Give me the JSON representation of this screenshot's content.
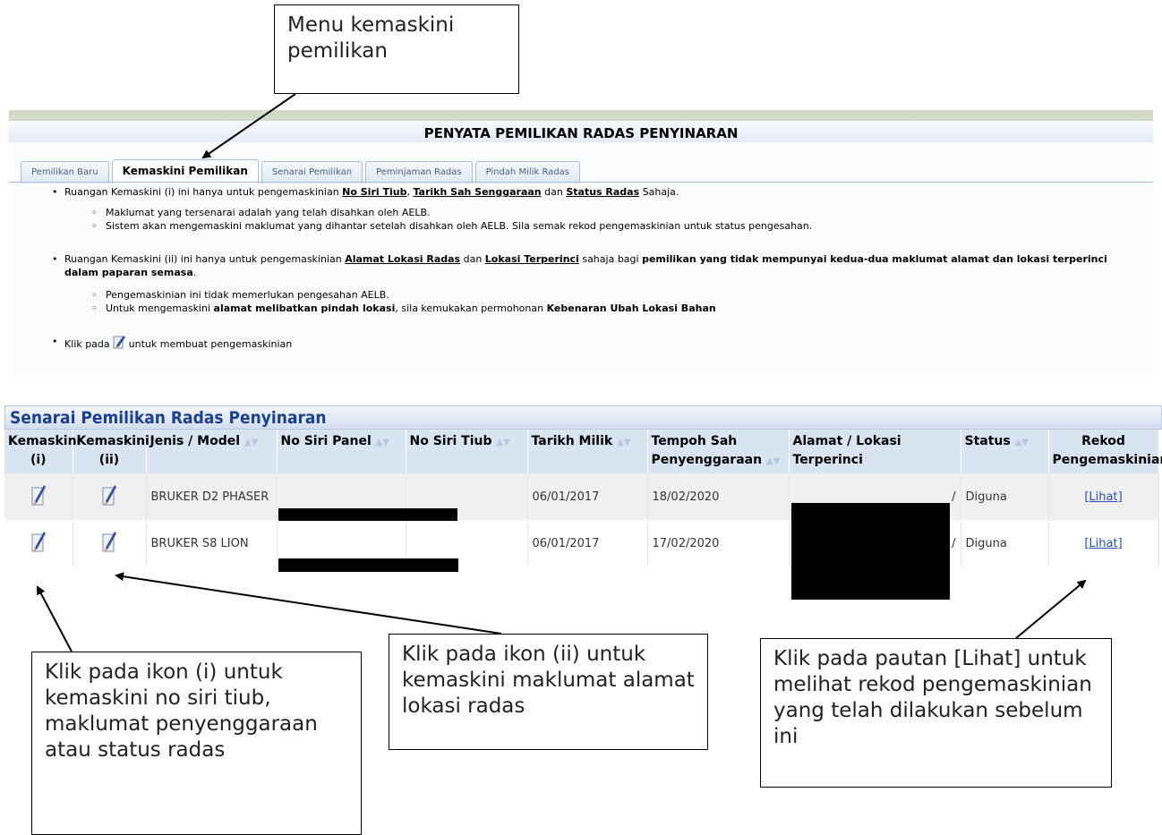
{
  "callouts": {
    "menu": "Menu kemaskini pemilikan",
    "icon_i": "Klik pada ikon (i) untuk kemaskini no siri tiub, maklumat penyenggaraan atau status radas",
    "icon_ii": "Klik pada ikon (ii) untuk kemaskini maklumat alamat lokasi radas",
    "lihat": "Klik pada pautan [Lihat] untuk melihat rekod pengemaskinian yang telah dilakukan sebelum ini"
  },
  "page_title": "PENYATA PEMILIKAN RADAS PENYINARAN",
  "tabs": [
    {
      "label": "Pemilikan Baru"
    },
    {
      "label": "Kemaskini Pemilikan"
    },
    {
      "label": "Senarai Pemilikan"
    },
    {
      "label": "Peminjaman Radas"
    },
    {
      "label": "Pindah Milik Radas"
    }
  ],
  "info": {
    "p1_a": "Ruangan Kemaskini (i) ini hanya untuk pengemaskinian ",
    "p1_l1": "No Siri Tiub",
    "p1_sep1": ", ",
    "p1_l2": "Tarikh Sah Senggaraan",
    "p1_and": " dan ",
    "p1_l3": "Status Radas",
    "p1_end": " Sahaja.",
    "s1": "Maklumat yang tersenarai adalah yang telah disahkan oleh AELB.",
    "s2": "Sistem akan mengemaskini maklumat yang dihantar setelah disahkan oleh AELB. Sila semak rekod pengemaskinian untuk status pengesahan.",
    "p2_a": "Ruangan Kemaskini (ii) ini hanya untuk pengemaskinian ",
    "p2_l1": "Alamat Lokasi Radas",
    "p2_and": " dan ",
    "p2_l2": "Lokasi Terperinci",
    "p2_b": " sahaja bagi ",
    "p2_bold": "pemilikan yang tidak mempunyai kedua-dua maklumat alamat dan lokasi terperinci dalam paparan semasa",
    "p2_end": ".",
    "s3": "Pengemaskinian ini tidak memerlukan pengesahan AELB.",
    "s4_a": "Untuk mengemaskini ",
    "s4_bold1": "alamat melibatkan pindah lokasi",
    "s4_b": ", sila kemukakan permohonan ",
    "s4_bold2": "Kebenaran Ubah Lokasi Bahan",
    "p3_a": "Klik pada ",
    "p3_b": " untuk membuat pengemaskinian"
  },
  "grid": {
    "title": "Senarai Pemilikan Radas Penyinaran",
    "headers": {
      "k1_a": "Kemaskini",
      "k1_b": "(i)",
      "k2_a": "Kemaskini",
      "k2_b": "(ii)",
      "jenis": "Jenis / Model",
      "panel": "No Siri Panel",
      "tiub": "No Siri Tiub",
      "tarikh": "Tarikh Milik",
      "tempoh_a": "Tempoh Sah",
      "tempoh_b": "Penyenggaraan",
      "alamat": "Alamat / Lokasi Terperinci",
      "status": "Status",
      "rekod_a": "Rekod",
      "rekod_b": "Pengemaskinian"
    },
    "rows": [
      {
        "model": "BRUKER D2 PHASER",
        "tarikh": "06/01/2017",
        "tempoh": "18/02/2020",
        "alamat": "/",
        "status": "Diguna",
        "lihat": "[Lihat]"
      },
      {
        "model": "BRUKER S8 LION",
        "tarikh": "06/01/2017",
        "tempoh": "17/02/2020",
        "alamat": "/",
        "status": "Diguna",
        "lihat": "[Lihat]"
      }
    ]
  }
}
